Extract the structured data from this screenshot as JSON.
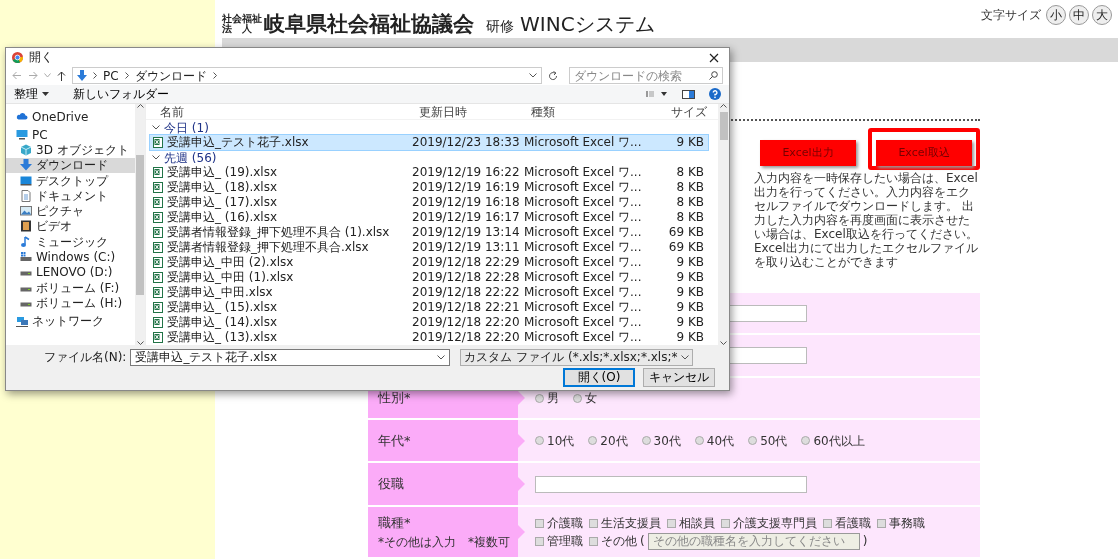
{
  "header": {
    "org_prefix_top": "社会福祉",
    "org_prefix_bottom": "法　人",
    "org_name": "岐阜県社会福祉協議会",
    "system_prefix": "研修",
    "system_name": "WINCシステム"
  },
  "font_size": {
    "label": "文字サイズ",
    "options": [
      {
        "label": "小"
      },
      {
        "label": "中"
      },
      {
        "label": "大"
      }
    ]
  },
  "excel_buttons": [
    {
      "label": "Excel出力",
      "highlighted": false
    },
    {
      "label": "Excel取込",
      "highlighted": true
    }
  ],
  "excel_note": "入力内容を一時保存したい場合は、Excel出力を行ってください。入力内容をエクセルファイルでダウンロードします。 出力した入力内容を再度画面に表示させたい場合は、Excel取込を行ってください。Excel出力にて出力したエクセルファイルを取り込むことができます",
  "form": {
    "rows": [
      {
        "kind": "text"
      },
      {
        "kind": "text"
      },
      {
        "kind": "radio",
        "label": "性別*",
        "options": [
          {
            "label": "男",
            "selected": false
          },
          {
            "label": "女",
            "selected": false
          }
        ]
      },
      {
        "kind": "radio",
        "label": "年代*",
        "options": [
          {
            "label": "10代",
            "selected": false
          },
          {
            "label": "20代",
            "selected": false
          },
          {
            "label": "30代",
            "selected": false
          },
          {
            "label": "40代",
            "selected": false
          },
          {
            "label": "50代",
            "selected": false
          },
          {
            "label": "60代以上",
            "selected": false
          }
        ]
      },
      {
        "kind": "text",
        "label": "役職"
      },
      {
        "kind": "checkbox",
        "label": "職種*",
        "note": "*その他は入力　*複数可",
        "options": [
          {
            "label": "介護職",
            "checked": false
          },
          {
            "label": "生活支援員",
            "checked": false
          },
          {
            "label": "相談員",
            "checked": false
          },
          {
            "label": "介護支援専門員",
            "checked": false
          },
          {
            "label": "看護職",
            "checked": false
          },
          {
            "label": "事務職",
            "checked": false
          },
          {
            "label": "管理職",
            "checked": false
          },
          {
            "label": "その他",
            "checked": false
          }
        ],
        "other_open": "(",
        "other_placeholder": "その他の職種名を入力してください",
        "other_close": ")"
      }
    ]
  },
  "dialog": {
    "title": "開く",
    "path": [
      "PC",
      "ダウンロード"
    ],
    "search_placeholder": "ダウンロードの検索",
    "organize": "整理",
    "new_folder": "新しいフォルダー",
    "sidebar": [
      {
        "kind": "cloud",
        "label": "OneDrive",
        "selected": false
      },
      {
        "kind": "pc",
        "label": "PC",
        "selected": false,
        "children": [
          {
            "kind": "cube",
            "label": "3D オブジェクト",
            "selected": false
          },
          {
            "kind": "download",
            "label": "ダウンロード",
            "selected": true
          },
          {
            "kind": "desktop",
            "label": "デスクトップ",
            "selected": false
          },
          {
            "kind": "document",
            "label": "ドキュメント",
            "selected": false
          },
          {
            "kind": "picture",
            "label": "ピクチャ",
            "selected": false
          },
          {
            "kind": "video",
            "label": "ビデオ",
            "selected": false
          },
          {
            "kind": "music",
            "label": "ミュージック",
            "selected": false
          },
          {
            "kind": "windrive",
            "label": "Windows (C:)",
            "selected": false
          },
          {
            "kind": "drive",
            "label": "LENOVO (D:)",
            "selected": false
          },
          {
            "kind": "drive",
            "label": "ボリューム (F:)",
            "selected": false
          },
          {
            "kind": "drive",
            "label": "ボリューム (H:)",
            "selected": false
          }
        ]
      },
      {
        "kind": "network",
        "label": "ネットワーク",
        "selected": false
      }
    ],
    "columns": [
      "名前",
      "更新日時",
      "種類",
      "サイズ"
    ],
    "groups": [
      {
        "label": "今日 (1)",
        "expanded": true,
        "files": [
          {
            "name": "受講申込_テスト花子.xlsx",
            "modified": "2019/12/23 18:33",
            "type": "Microsoft Excel ワ...",
            "size": "9 KB",
            "selected": true
          }
        ]
      },
      {
        "label": "先週 (56)",
        "expanded": true,
        "files": [
          {
            "name": "受講申込_ (19).xlsx",
            "modified": "2019/12/19 16:22",
            "type": "Microsoft Excel ワ...",
            "size": "8 KB",
            "selected": false
          },
          {
            "name": "受講申込_ (18).xlsx",
            "modified": "2019/12/19 16:19",
            "type": "Microsoft Excel ワ...",
            "size": "8 KB",
            "selected": false
          },
          {
            "name": "受講申込_ (17).xlsx",
            "modified": "2019/12/19 16:18",
            "type": "Microsoft Excel ワ...",
            "size": "8 KB",
            "selected": false
          },
          {
            "name": "受講申込_ (16).xlsx",
            "modified": "2019/12/19 16:17",
            "type": "Microsoft Excel ワ...",
            "size": "8 KB",
            "selected": false
          },
          {
            "name": "受講者情報登録_押下処理不具合 (1).xlsx",
            "modified": "2019/12/19 13:14",
            "type": "Microsoft Excel ワ...",
            "size": "69 KB",
            "selected": false
          },
          {
            "name": "受講者情報登録_押下処理不具合.xlsx",
            "modified": "2019/12/19 13:11",
            "type": "Microsoft Excel ワ...",
            "size": "69 KB",
            "selected": false
          },
          {
            "name": "受講申込_中田 (2).xlsx",
            "modified": "2019/12/18 22:29",
            "type": "Microsoft Excel ワ...",
            "size": "9 KB",
            "selected": false
          },
          {
            "name": "受講申込_中田 (1).xlsx",
            "modified": "2019/12/18 22:28",
            "type": "Microsoft Excel ワ...",
            "size": "9 KB",
            "selected": false
          },
          {
            "name": "受講申込_中田.xlsx",
            "modified": "2019/12/18 22:22",
            "type": "Microsoft Excel ワ...",
            "size": "9 KB",
            "selected": false
          },
          {
            "name": "受講申込_ (15).xlsx",
            "modified": "2019/12/18 22:21",
            "type": "Microsoft Excel ワ...",
            "size": "9 KB",
            "selected": false
          },
          {
            "name": "受講申込_ (14).xlsx",
            "modified": "2019/12/18 22:20",
            "type": "Microsoft Excel ワ...",
            "size": "9 KB",
            "selected": false
          },
          {
            "name": "受講申込_ (13).xlsx",
            "modified": "2019/12/18 22:20",
            "type": "Microsoft Excel ワ...",
            "size": "9 KB",
            "selected": false
          }
        ]
      }
    ],
    "filename_label": "ファイル名(N):",
    "filename": "受講申込_テスト花子.xlsx",
    "filter": "カスタム ファイル (*.xls;*.xlsx;*.xls;*",
    "open_button": "開く(O)",
    "cancel_button": "キャンセル"
  }
}
